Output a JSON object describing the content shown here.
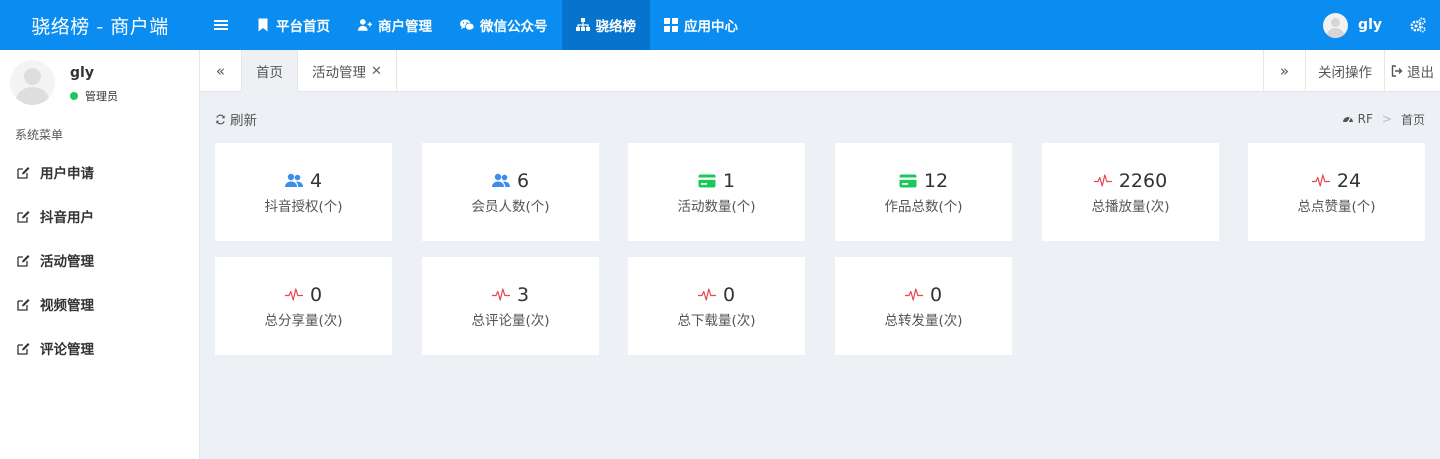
{
  "brand": "骁络榜 - 商户端",
  "nav": [
    {
      "label": "平台首页",
      "icon": "bookmark-icon",
      "active": false
    },
    {
      "label": "商户管理",
      "icon": "user-plus-icon",
      "active": false
    },
    {
      "label": "微信公众号",
      "icon": "wechat-icon",
      "active": false
    },
    {
      "label": "骁络榜",
      "icon": "sitemap-icon",
      "active": true
    },
    {
      "label": "应用中心",
      "icon": "grid-icon",
      "active": false
    }
  ],
  "topbar": {
    "username": "gly"
  },
  "sidebar": {
    "user_name": "gly",
    "user_role": "管理员",
    "menu_header": "系统菜单",
    "items": [
      {
        "label": "用户申请"
      },
      {
        "label": "抖音用户"
      },
      {
        "label": "活动管理"
      },
      {
        "label": "视频管理"
      },
      {
        "label": "评论管理"
      }
    ]
  },
  "tabs": {
    "left_arrow": "«",
    "right_arrow": "»",
    "home": "首页",
    "active": "活动管理",
    "close": "✕",
    "close_ops": "关闭操作",
    "logout": "退出"
  },
  "content": {
    "refresh": "刷新",
    "breadcrumb": {
      "root": "RF",
      "sep": ">",
      "current": "首页"
    }
  },
  "colors": {
    "brand": "#0a8cf0",
    "nav_active": "#0673cc",
    "users_icon": "#3c8dec",
    "card_icon": "#1bc95a",
    "pulse_icon": "#e8464e"
  },
  "stats": [
    {
      "value": "4",
      "label": "抖音授权(个)",
      "icon": "users-icon"
    },
    {
      "value": "6",
      "label": "会员人数(个)",
      "icon": "users-icon"
    },
    {
      "value": "1",
      "label": "活动数量(个)",
      "icon": "credit-card-icon"
    },
    {
      "value": "12",
      "label": "作品总数(个)",
      "icon": "credit-card-icon"
    },
    {
      "value": "2260",
      "label": "总播放量(次)",
      "icon": "heartbeat-icon"
    },
    {
      "value": "24",
      "label": "总点赞量(个)",
      "icon": "heartbeat-icon"
    },
    {
      "value": "0",
      "label": "总分享量(次)",
      "icon": "heartbeat-icon"
    },
    {
      "value": "3",
      "label": "总评论量(次)",
      "icon": "heartbeat-icon"
    },
    {
      "value": "0",
      "label": "总下载量(次)",
      "icon": "heartbeat-icon"
    },
    {
      "value": "0",
      "label": "总转发量(次)",
      "icon": "heartbeat-icon"
    }
  ]
}
